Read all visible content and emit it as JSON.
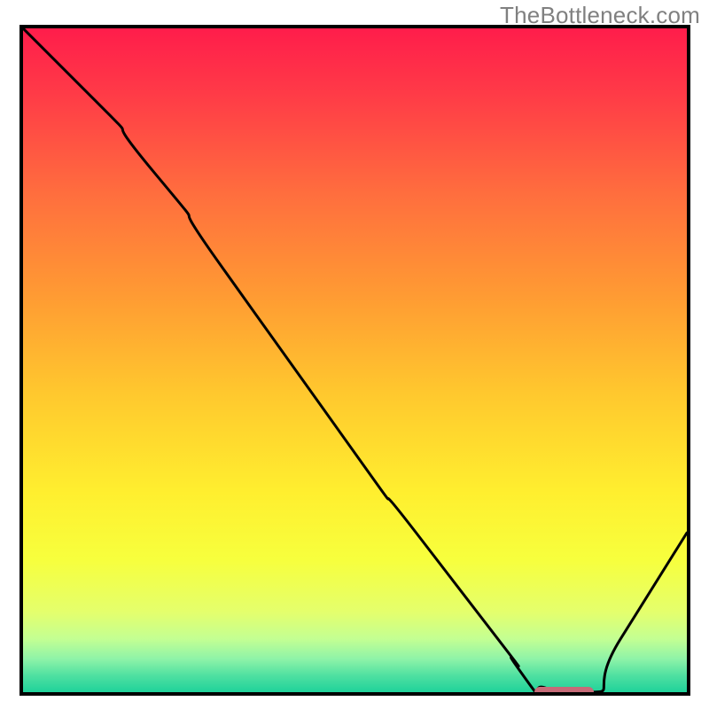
{
  "watermark_text": "TheBottleneck.com",
  "chart_data": {
    "type": "line",
    "title": "",
    "xlabel": "",
    "ylabel": "",
    "xlim": [
      0,
      100
    ],
    "ylim": [
      0,
      100
    ],
    "grid": false,
    "legend": false,
    "series": [
      {
        "name": "bottleneck-curve",
        "x": [
          0,
          10,
          20,
          30,
          40,
          50,
          60,
          70,
          75,
          80,
          85,
          90,
          100
        ],
        "y": [
          100,
          90,
          78,
          64,
          50,
          36,
          23,
          10,
          3,
          0,
          0,
          8,
          24
        ],
        "color": "#000000",
        "stroke_width": 3
      }
    ],
    "optimal_marker": {
      "x_start": 77,
      "x_end": 86,
      "color": "#c76b78"
    },
    "background_gradient": {
      "type": "vertical",
      "stops": [
        {
          "offset": 0.0,
          "color": "#ff1d4b"
        },
        {
          "offset": 0.1,
          "color": "#ff3b47"
        },
        {
          "offset": 0.25,
          "color": "#ff6e3e"
        },
        {
          "offset": 0.4,
          "color": "#ff9a33"
        },
        {
          "offset": 0.55,
          "color": "#ffc82e"
        },
        {
          "offset": 0.7,
          "color": "#ffef2f"
        },
        {
          "offset": 0.8,
          "color": "#f7ff3d"
        },
        {
          "offset": 0.88,
          "color": "#e4ff6d"
        },
        {
          "offset": 0.92,
          "color": "#c3ff93"
        },
        {
          "offset": 0.95,
          "color": "#8ef3a8"
        },
        {
          "offset": 0.975,
          "color": "#4fe0a1"
        },
        {
          "offset": 1.0,
          "color": "#1fd29a"
        }
      ]
    }
  }
}
